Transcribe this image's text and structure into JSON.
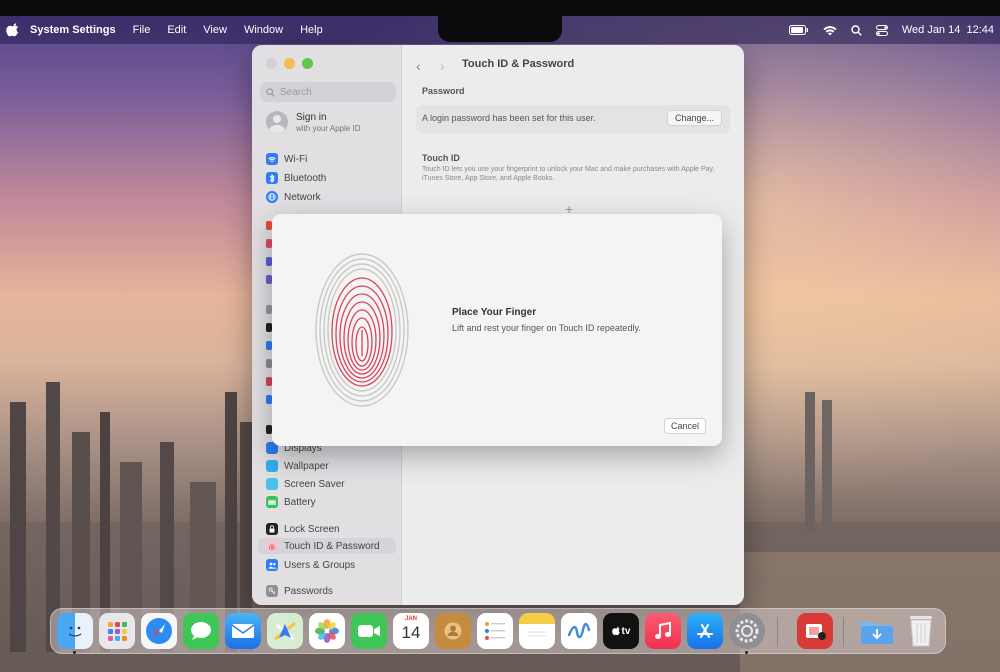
{
  "menubar": {
    "app_name": "System Settings",
    "menus": [
      "File",
      "Edit",
      "View",
      "Window",
      "Help"
    ],
    "datetime": "Wed Jan 14  12:44"
  },
  "window": {
    "title": "Touch ID & Password",
    "search_placeholder": "Search",
    "account": {
      "title": "Sign in",
      "subtitle": "with your Apple ID"
    },
    "sidebar": {
      "items": [
        {
          "label": "Wi-Fi",
          "icon": "wifi-icon",
          "color": "#2f7cf6"
        },
        {
          "label": "Bluetooth",
          "icon": "bluetooth-icon",
          "color": "#2f7cf6"
        },
        {
          "label": "Network",
          "icon": "globe-icon",
          "color": "#2f7cf6"
        },
        {
          "label": "Displays",
          "icon": "display-icon",
          "color": "#2f7cf6"
        },
        {
          "label": "Wallpaper",
          "icon": "wallpaper-icon",
          "color": "#32aef0"
        },
        {
          "label": "Screen Saver",
          "icon": "screensaver-icon",
          "color": "#46c3e8"
        },
        {
          "label": "Battery",
          "icon": "battery-icon",
          "color": "#37c25a"
        },
        {
          "label": "Lock Screen",
          "icon": "lock-icon",
          "color": "#222222"
        },
        {
          "label": "Touch ID & Password",
          "icon": "fingerprint-icon",
          "color": "#ee7082",
          "selected": true
        },
        {
          "label": "Users & Groups",
          "icon": "users-icon",
          "color": "#2f7cf6"
        },
        {
          "label": "Passwords",
          "icon": "key-icon",
          "color": "#8e8e93"
        }
      ]
    },
    "password_section": {
      "heading": "Password",
      "status": "A login password has been set for this user.",
      "change_label": "Change..."
    },
    "touchid_section": {
      "heading": "Touch ID",
      "description": "Touch ID lets you use your fingerprint to unlock your Mac and make purchases with Apple Pay, iTunes Store, App Store, and Apple Books."
    }
  },
  "dialog": {
    "title": "Place Your Finger",
    "message": "Lift and rest your finger on Touch ID repeatedly.",
    "cancel_label": "Cancel"
  },
  "dock": {
    "calendar": {
      "month": "JAN",
      "day": "14"
    },
    "tv_label": "tv",
    "apps": [
      "finder-icon",
      "launchpad-icon",
      "safari-icon",
      "messages-icon",
      "mail-icon",
      "maps-icon",
      "photos-icon",
      "facetime-icon",
      "calendar-icon",
      "contacts-icon",
      "reminders-icon",
      "notes-icon",
      "freeform-icon",
      "appletv-icon",
      "music-icon",
      "appstore-icon",
      "system-settings-icon",
      "photo-booth-icon",
      "downloads-icon",
      "trash-icon"
    ]
  }
}
